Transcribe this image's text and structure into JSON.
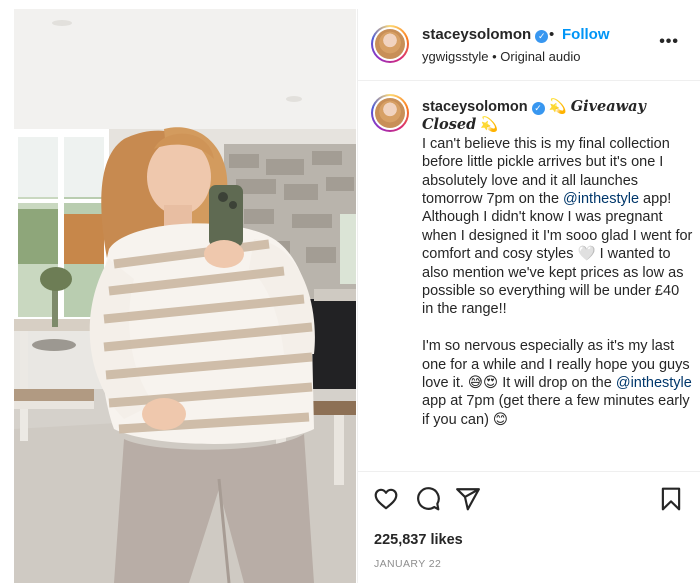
{
  "post": {
    "username": "staceysolomon",
    "verified_mark": "✓",
    "separator": "•",
    "follow_label": "Follow",
    "audio_user": "ygwigsstyle",
    "audio_separator": " • ",
    "audio_label": "Original audio",
    "more_label": "•••"
  },
  "caption": {
    "username": "staceysolomon",
    "emoji_star": "💫",
    "giveaway_closed": "Giveaway Closed",
    "p1_a": "I can't believe this is my final collection before little pickle arrives but it's one I absolutely love and it all launches tomorrow 7pm on the ",
    "mention1": "@inthestyle",
    "p1_b": " app! Although I didn't know I was pregnant when I designed it I'm sooo glad I went for comfort and cosy styles 🤍 I wanted to also mention we've kept prices as low as possible so everything will be under £40 in the range!!",
    "p2_a": "I'm so nervous especially as it's my last one for a while and I really hope you guys love it. 😅😍 It will drop on the ",
    "mention2": "@inthestyle",
    "p2_b": " app at 7pm (get there a few minutes early if you can) 😊"
  },
  "actions": {
    "icons": [
      "heart-icon",
      "comment-icon",
      "share-icon",
      "bookmark-icon"
    ],
    "likes": "225,837 likes",
    "date": "JANUARY 22"
  },
  "colors": {
    "follow": "#0095f6",
    "mention": "#00376b",
    "verified": "#3897f0",
    "muted": "#8e8e8e"
  }
}
